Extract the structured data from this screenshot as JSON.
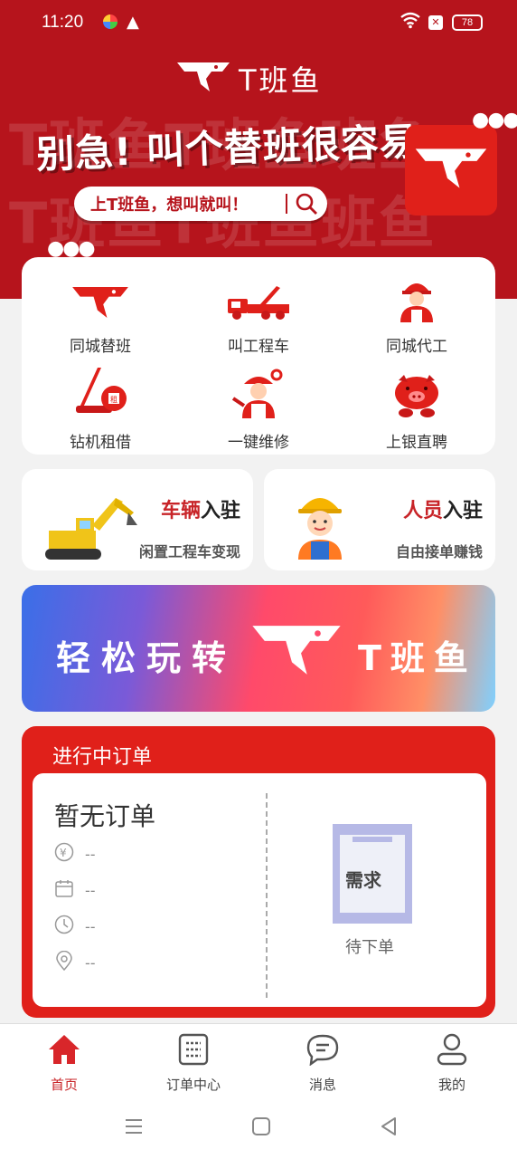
{
  "status_bar": {
    "time": "11:20",
    "battery": "78",
    "icons": [
      "app-icon",
      "warning-icon",
      "wifi-icon",
      "no-sim-icon",
      "battery-icon"
    ]
  },
  "brand": {
    "title": "T班鱼",
    "watermark_lines": [
      "T班鱼T班鱼班鱼",
      "T班鱼T班鱼班鱼"
    ]
  },
  "hero": {
    "slogan": "别急! 叫个替班很容易",
    "search_text": "上T班鱼，想叫就叫！"
  },
  "services": [
    {
      "label": "同城替班",
      "icon": "fish-logo-icon"
    },
    {
      "label": "叫工程车",
      "icon": "crane-truck-icon"
    },
    {
      "label": "同城代工",
      "icon": "worker-icon"
    },
    {
      "label": "钻机租借",
      "icon": "drill-rig-icon"
    },
    {
      "label": "一键维修",
      "icon": "repair-worker-icon"
    },
    {
      "label": "上银直聘",
      "icon": "pig-icon"
    }
  ],
  "entries": {
    "vehicle": {
      "title_red": "车辆",
      "title_black": "入驻",
      "subtitle": "闲置工程车变现"
    },
    "personnel": {
      "title_red": "人员",
      "title_black": "入驻",
      "subtitle": "自由接单赚钱"
    }
  },
  "banner": {
    "text": "轻松玩转",
    "tag": "T班鱼"
  },
  "orders": {
    "title": "进行中订单",
    "empty": "暂无订单",
    "price": "--",
    "date": "--",
    "time": "--",
    "location": "--",
    "doc_word": "需求",
    "pending": "待下单"
  },
  "tabbar": [
    {
      "label": "首页",
      "icon": "home-icon",
      "active": true
    },
    {
      "label": "订单中心",
      "icon": "order-list-icon",
      "active": false
    },
    {
      "label": "消息",
      "icon": "message-icon",
      "active": false
    },
    {
      "label": "我的",
      "icon": "profile-icon",
      "active": false
    }
  ],
  "colors": {
    "brand_red": "#b6141c",
    "accent_red": "#e0201a",
    "text_dark": "#333333"
  }
}
